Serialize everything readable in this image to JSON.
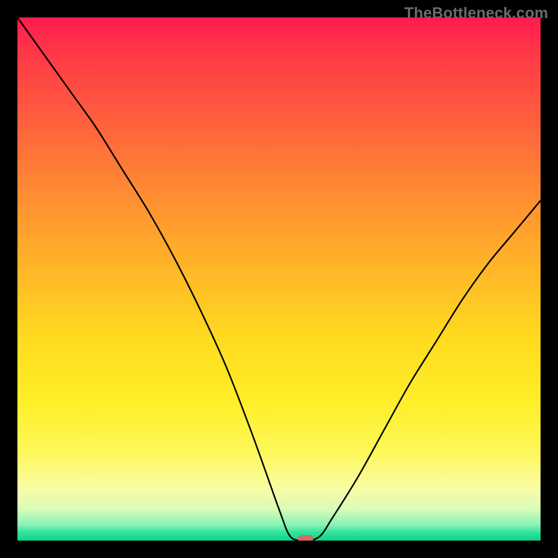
{
  "watermark": "TheBottleneck.com",
  "colors": {
    "page_bg": "#000000",
    "curve": "#000000",
    "marker": "#d36a63",
    "gradient_top": "#ff1a4d",
    "gradient_bottom": "#09d58d"
  },
  "chart_data": {
    "type": "line",
    "title": "",
    "xlabel": "",
    "ylabel": "",
    "xlim": [
      0,
      100
    ],
    "ylim": [
      0,
      100
    ],
    "grid": false,
    "background": "rainbow-vertical-gradient",
    "series": [
      {
        "name": "bottleneck-curve",
        "x": [
          0,
          5,
          10,
          15,
          20,
          25,
          30,
          35,
          40,
          45,
          50,
          52,
          54,
          56,
          58,
          60,
          65,
          70,
          75,
          80,
          85,
          90,
          95,
          100
        ],
        "values": [
          100,
          93,
          86,
          79,
          71,
          63,
          54,
          44,
          33,
          20,
          6,
          1,
          0,
          0,
          1,
          4,
          12,
          21,
          30,
          38,
          46,
          53,
          59,
          65
        ]
      }
    ],
    "marker": {
      "x": 55,
      "y": 0,
      "shape": "rounded-rect"
    },
    "notes": "Axes have no visible tick labels; x and y are normalized 0-100. Background is a vertical red→orange→yellow→green gradient (red = high bottleneck, green = low). Curve dips to zero near x≈55."
  }
}
